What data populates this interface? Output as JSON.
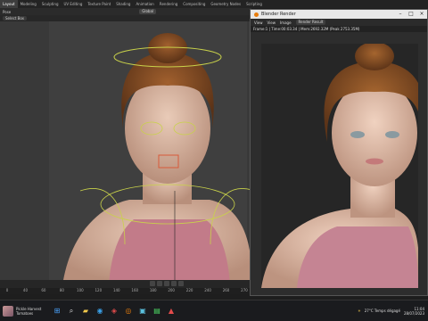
{
  "tabs": [
    "Layout",
    "Modeling",
    "Sculpting",
    "UV Editing",
    "Texture Paint",
    "Shading",
    "Animation",
    "Rendering",
    "Compositing",
    "Geometry Nodes",
    "Scripting"
  ],
  "active_tab": 0,
  "header": {
    "pose_label": "Pose",
    "orientation_label": "Global",
    "select_box_label": "Select Box"
  },
  "render_window": {
    "title": "Blender Render",
    "menu": [
      "View",
      "View",
      "Image"
    ],
    "slot_label": "Render Result",
    "info": "Frame:1 | Time:00:03.34 | Mem:2692.32M (Peak 2753.35M)"
  },
  "timeline": {
    "ticks": [
      "0",
      "40",
      "60",
      "80",
      "100",
      "120",
      "140",
      "160",
      "180",
      "200",
      "220",
      "240",
      "260",
      "270"
    ],
    "current_frame": "1"
  },
  "taskbar": {
    "news_line1": "Pickle Harvest",
    "news_line2": "Tomatoes",
    "weather": "27°C",
    "weather_desc": "Temps dégagé",
    "time": "11:04",
    "date": "28/07/2023",
    "center_item": "Your Lemonade Menu",
    "colors": {
      "accent": "#e87d0d",
      "taskbar": "#1a1b1e"
    }
  }
}
